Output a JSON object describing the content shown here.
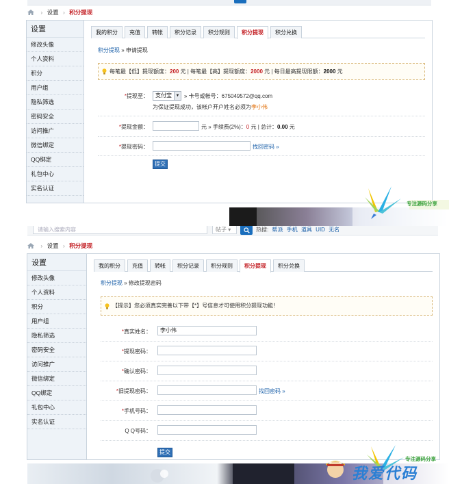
{
  "breadcrumb": {
    "sep": "›",
    "parent": "设置",
    "current": "积分提现"
  },
  "sidebar": {
    "title": "设置",
    "items": [
      "修改头像",
      "个人资料",
      "积分",
      "用户组",
      "隐私筛选",
      "密码安全",
      "访问推广",
      "微信绑定",
      "QQ绑定",
      "礼包中心",
      "实名认证"
    ]
  },
  "tabs": [
    "我的积分",
    "充值",
    "转帐",
    "积分记录",
    "积分规则",
    "积分提现",
    "积分兑换"
  ],
  "active_tab": "积分提现",
  "top_search": {
    "placeholder": "请输入搜索内容",
    "scope": "帖子",
    "scope_arrow": "▾",
    "hot_label": "热搜:",
    "hot_items": [
      "帮派",
      "手机",
      "道具",
      "UID",
      "无名"
    ]
  },
  "withdraw": {
    "crumb_link": "积分提现",
    "crumb_rest": " » 申请提现",
    "tip": {
      "p1": "每笔最【低】提现额度：",
      "v1": "200",
      "p2": " 元 | 每笔最【高】提现额度：",
      "v2": "2000",
      "p3": " 元 | 每日最高提现限额：",
      "v3": "2000",
      "p4": " 元"
    },
    "to_label": "提现至：",
    "method": "支付宝",
    "account_text": "» 卡号或帐号：675049572@qq.com",
    "note_prefix": "为保证提现成功，该帐户开户姓名必须为",
    "owner": "李小伟",
    "amount_label": "提现金额：",
    "amount_unit": "元 » 手续费(2%)：",
    "fee": "0",
    "fee_unit": " 元 | 总计：",
    "total": "0.00",
    "total_unit": " 元",
    "pwd_label": "提现密码：",
    "forgot_link": "找回密码 »",
    "submit": "提交"
  },
  "modify": {
    "crumb_link": "积分提现",
    "crumb_rest": " » 修改提现密码",
    "tip": "【提示】您必须真实完善以下带【*】号信息才可使用积分提现功能！",
    "fields": [
      {
        "label": "真实姓名：",
        "value": "李小伟"
      },
      {
        "label": "提现密码：",
        "value": ""
      },
      {
        "label": "确认密码：",
        "value": ""
      },
      {
        "label": "旧提现密码：",
        "value": ""
      },
      {
        "label": "手机号码：",
        "value": ""
      }
    ],
    "qq_label": "Q Q号码：",
    "forgot_link": "找回密码 »",
    "submit": "提交"
  },
  "watermark": {
    "slogan": "专注源码分享",
    "brand": "我爱代码"
  },
  "colors": {
    "accent_red": "#c31f24",
    "link_blue": "#1a5fa8",
    "button_blue": "#2f6fb5",
    "side_bg": "#eef3f8"
  }
}
